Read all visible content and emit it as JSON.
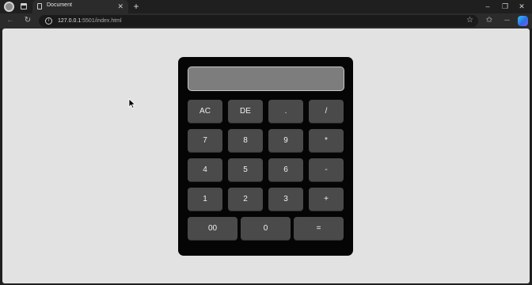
{
  "browser": {
    "tab": {
      "title": "Document",
      "close_glyph": "✕"
    },
    "new_tab_glyph": "+",
    "window_controls": {
      "minimize_glyph": "–",
      "restore_glyph": "❐",
      "close_glyph": "✕"
    },
    "nav": {
      "back_glyph": "←",
      "refresh_glyph": "↻"
    },
    "address": {
      "info_glyph": "i",
      "url_host": "127.0.0.1",
      "url_rest": ":5501/index.html"
    },
    "toolbar": {
      "star_glyph": "☆",
      "favorites_glyph": "✩",
      "more_glyph": "···"
    },
    "icons": [
      "profile-icon",
      "workspaces-icon",
      "page-icon",
      "close-icon",
      "plus-icon",
      "minimize-icon",
      "restore-icon",
      "back-arrow-icon",
      "refresh-icon",
      "info-icon",
      "star-icon",
      "favorites-icon",
      "more-icon",
      "copilot-icon"
    ]
  },
  "calculator": {
    "display_value": "",
    "keys": {
      "ac": "AC",
      "de": "DE",
      "dot": ".",
      "divide": "/",
      "seven": "7",
      "eight": "8",
      "nine": "9",
      "multiply": "*",
      "four": "4",
      "five": "5",
      "six": "6",
      "minus": "-",
      "one": "1",
      "two": "2",
      "three": "3",
      "plus": "+",
      "double_zero": "00",
      "zero": "0",
      "equals": "="
    },
    "colors": {
      "body": "#050505",
      "display": "#7d7d7d",
      "key": "#4a4a4a",
      "page_background": "#e2e2e2"
    }
  }
}
